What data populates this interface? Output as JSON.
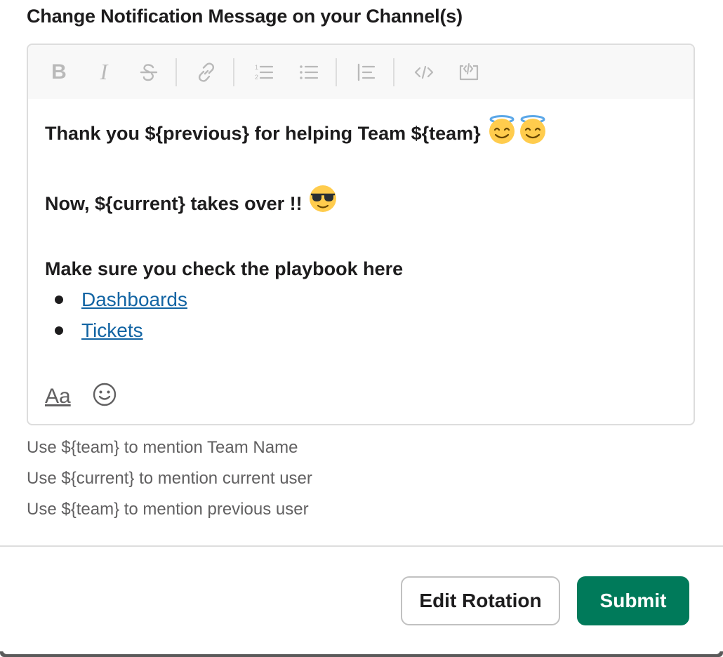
{
  "section": {
    "title": "Change Notification Message on your Channel(s)"
  },
  "toolbar": {
    "bold": "B",
    "italic": "I",
    "icons": [
      "bold-icon",
      "italic-icon",
      "strikethrough-icon",
      "link-icon",
      "ordered-list-icon",
      "bulleted-list-icon",
      "blockquote-icon",
      "code-icon",
      "code-block-icon"
    ]
  },
  "message": {
    "line1": "Thank you ${previous} for helping Team ${team}",
    "line1_emoji": "😇😇",
    "line2": "Now, ${current} takes over !!",
    "line2_emoji": "😎",
    "line3": "Make sure you check the playbook here",
    "links": [
      {
        "label": "Dashboards"
      },
      {
        "label": "Tickets"
      }
    ]
  },
  "composer": {
    "format_label": "Aa",
    "emoji_icon": "smiley-icon"
  },
  "hints": [
    "Use ${team} to mention Team Name",
    "Use ${current} to mention current user",
    "Use ${team} to mention previous user"
  ],
  "actions": {
    "edit_rotation": "Edit Rotation",
    "submit": "Submit"
  },
  "colors": {
    "primary": "#007a5a",
    "link": "#1264a3",
    "muted": "#616061",
    "toolbar_icon": "#b9b9b9"
  }
}
